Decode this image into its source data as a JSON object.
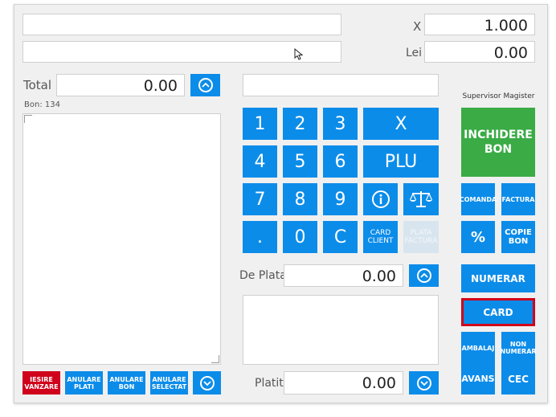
{
  "top": {
    "x_label": "X",
    "lei_label": "Lei",
    "quantity": "1.000",
    "price": "0.00"
  },
  "left": {
    "total_label": "Total",
    "total_value": "0.00",
    "bon_label": "Bon: 134"
  },
  "keypad": {
    "k1": "1",
    "k2": "2",
    "k3": "3",
    "kx": "X",
    "k4": "4",
    "k5": "5",
    "k6": "6",
    "plu": "PLU",
    "k7": "7",
    "k8": "8",
    "k9": "9",
    "kdot": ".",
    "k0": "0",
    "kc": "C",
    "card_client": "CARD CLIENT",
    "plata_factura": "PLATA FACTURA"
  },
  "middle": {
    "de_plata_label": "De Plata",
    "de_plata_value": "0.00",
    "platit_label": "Platit",
    "platit_value": "0.00"
  },
  "bottom_buttons": {
    "iesire": "IESIRE VANZARE",
    "anulare_plati": "ANULARE PLATI",
    "anulare_bon": "ANULARE BON",
    "anulare_selectat": "ANULARE SELECTAT"
  },
  "right": {
    "supervisor": "Supervisor Magister",
    "inchidere": "INCHIDERE BON",
    "comanda": "COMANDA",
    "factura": "FACTURA",
    "percent": "%",
    "copie_bon": "COPIE BON",
    "numerar": "NUMERAR",
    "card": "CARD",
    "ambalaj": "AMBALAJ",
    "non_numerar": "NON NUMERAR",
    "avans": "AVANS",
    "cec": "CEC"
  },
  "colors": {
    "accent": "#0c8ce9",
    "green": "#3aab45",
    "red": "#d0021b",
    "disabled": "#d8e5ef"
  }
}
